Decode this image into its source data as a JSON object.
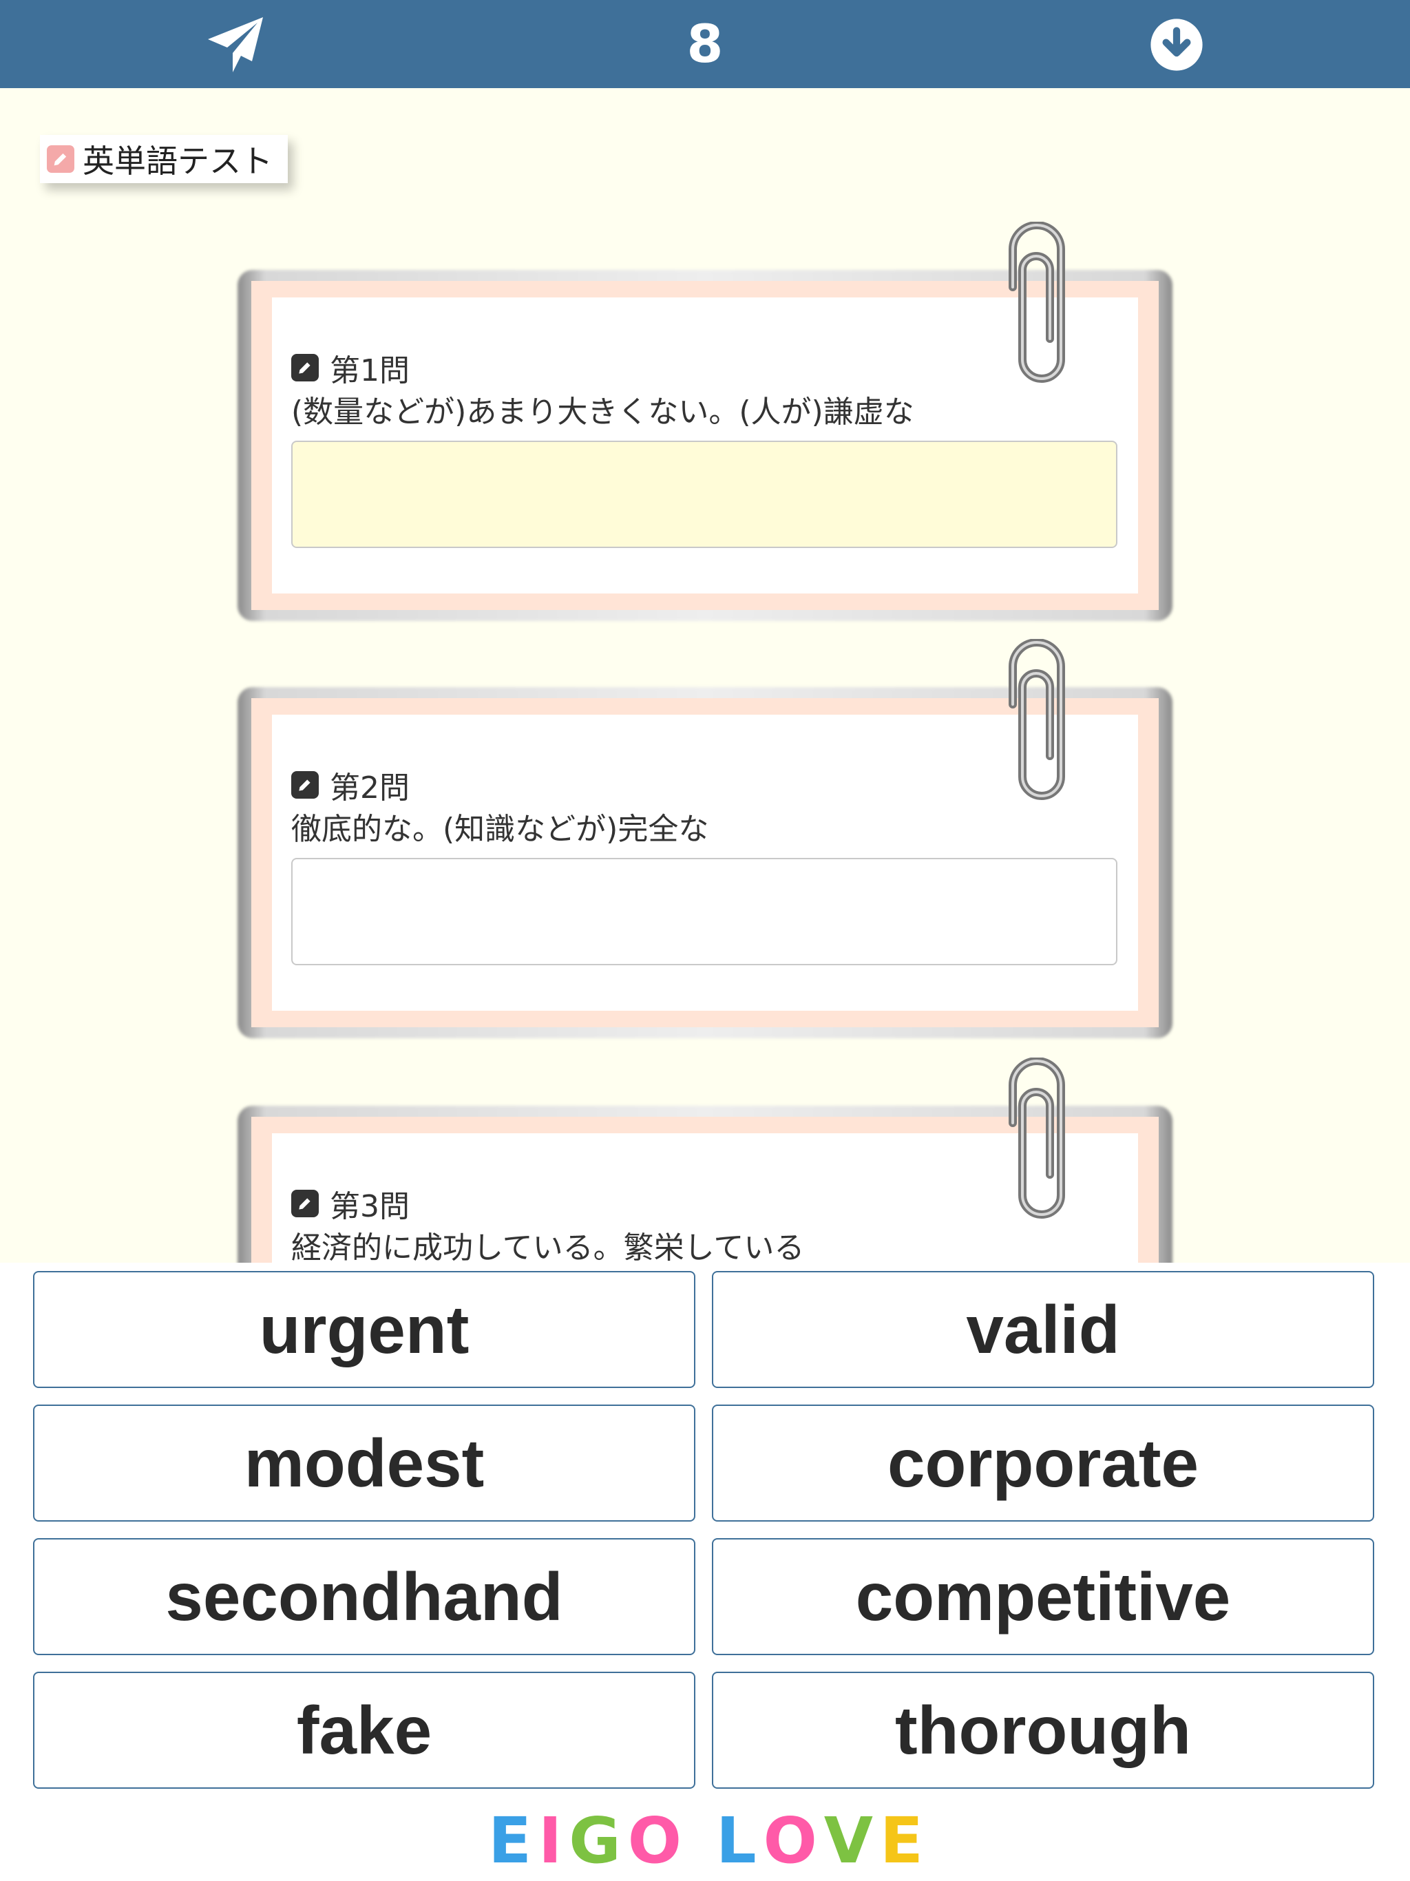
{
  "header": {
    "counter": "8",
    "left_icon": "paper-plane-icon",
    "right_icon": "download-circle-icon",
    "color": "#3f7099"
  },
  "test_tag": {
    "label": "英単語テスト",
    "icon": "pencil-icon"
  },
  "questions": [
    {
      "label": "第1問",
      "text": "(数量などが)あまり大きくない。(人が)謙虚な",
      "answer": ""
    },
    {
      "label": "第2問",
      "text": "徹底的な。(知識などが)完全な",
      "answer": ""
    },
    {
      "label": "第3問",
      "text": "経済的に成功している。繁栄している",
      "answer": ""
    }
  ],
  "choices": [
    {
      "label": "urgent"
    },
    {
      "label": "valid"
    },
    {
      "label": "modest"
    },
    {
      "label": "corporate"
    },
    {
      "label": "secondhand"
    },
    {
      "label": "competitive"
    },
    {
      "label": "fake"
    },
    {
      "label": "thorough"
    }
  ],
  "logo": {
    "letters": [
      "E",
      "I",
      "G",
      "O",
      " ",
      "L",
      "O",
      "V",
      "E"
    ],
    "colors": [
      "#3aa0e6",
      "#ff5aa8",
      "#7dc242",
      "#ff5aa8",
      "#ffffff",
      "#3aa0e6",
      "#ff5aa8",
      "#7dc242",
      "#f5c518"
    ]
  }
}
